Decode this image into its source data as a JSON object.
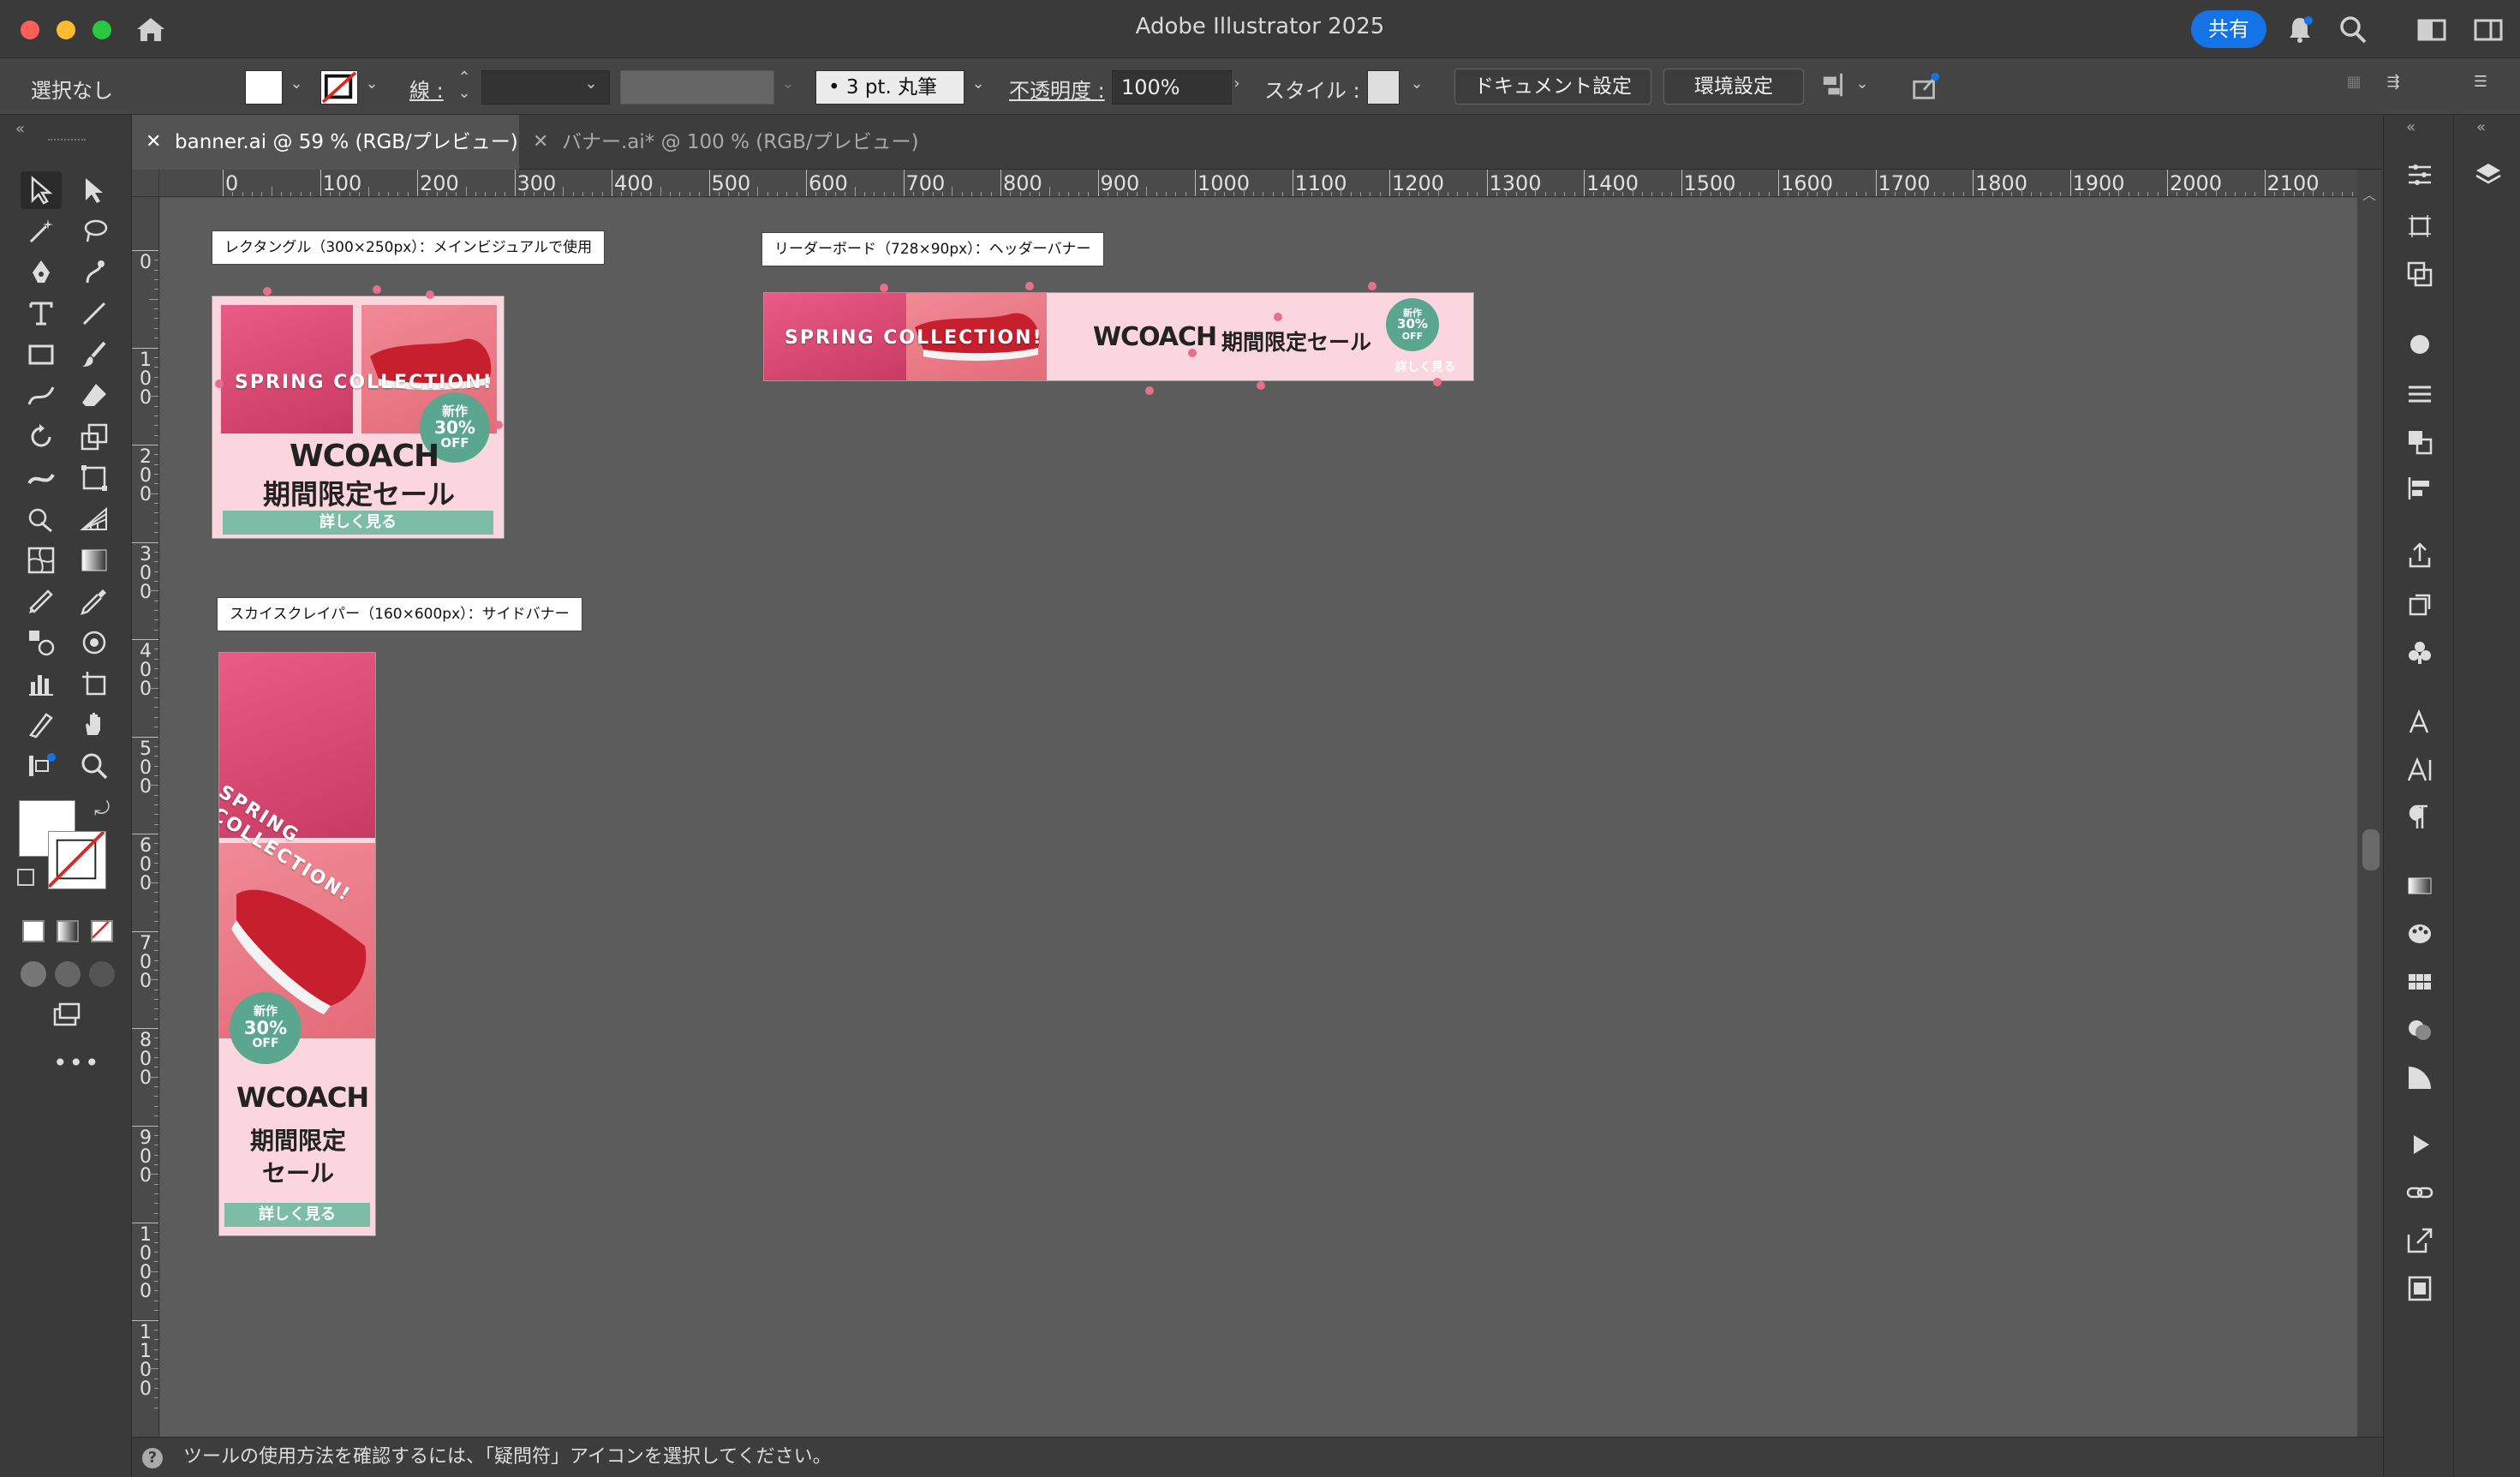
{
  "app": {
    "title": "Adobe Illustrator 2025",
    "share_label": "共有"
  },
  "control_bar": {
    "selection": "選択なし",
    "stroke_label": "線 :",
    "brush_value": "3 pt. 丸筆",
    "opacity_label": "不透明度 :",
    "opacity_value": "100%",
    "style_label": "スタイル :",
    "doc_setup": "ドキュメント設定",
    "prefs": "環境設定"
  },
  "tabs": [
    {
      "label": "banner.ai @ 59 % (RGB/プレビュー)",
      "active": true
    },
    {
      "label": "バナー.ai* @ 100 % (RGB/プレビュー)",
      "active": false
    }
  ],
  "ruler": {
    "h_ticks": [
      "0",
      "100",
      "200",
      "300",
      "400",
      "500",
      "600",
      "700",
      "800",
      "900",
      "1000",
      "1100",
      "1200",
      "1300",
      "1400",
      "1500",
      "1600",
      "1700",
      "1800",
      "1900",
      "2000",
      "2100"
    ],
    "v_ticks": [
      "0",
      "100",
      "200",
      "300",
      "400",
      "500",
      "600",
      "700",
      "800",
      "900",
      "1000",
      "1100"
    ]
  },
  "artboards": {
    "rect_label": "レクタングル（300×250px）：メインビジュアルで使用",
    "leader_label": "リーダーボード（728×90px）：ヘッダーバナー",
    "sky_label": "スカイスクレイパー（160×600px）：サイドバナー"
  },
  "banner": {
    "spring": "SPRING COLLECTION!",
    "spring_line1": "SPRING",
    "spring_line2": "COLLECTION!",
    "logo": "WCOACH",
    "sale": "期間限定セール",
    "sale_line1": "期間限定",
    "sale_line2": "セール",
    "cta": "詳しく見る",
    "badge_new": "新作",
    "badge_pct": "30%",
    "badge_off": "OFF"
  },
  "status": "ツールの使用方法を確認するには、「疑問符」アイコンを選択してください。",
  "colors": {
    "accent": "#1473e6",
    "banner_bg": "#fbd6de",
    "cta": "#7dbca7",
    "badge": "#5aa68f"
  }
}
